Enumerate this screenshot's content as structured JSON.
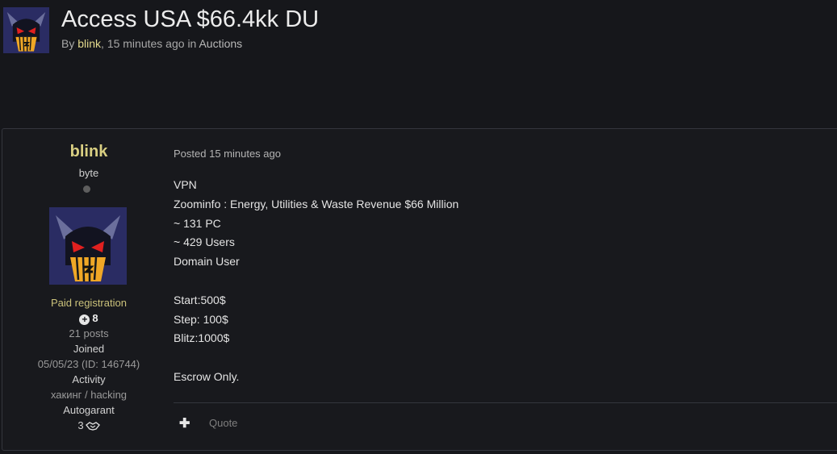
{
  "topic": {
    "title": "Access USA $66.4kk DU",
    "by_label": "By",
    "author": "blink",
    "time_ago": "15 minutes ago",
    "in_label": "in",
    "forum": "Auctions"
  },
  "author_panel": {
    "name": "blink",
    "rank": "byte",
    "group": "Paid registration",
    "reputation": "8",
    "posts": "21 posts",
    "joined_label": "Joined",
    "joined_value": "05/05/23 (ID: 146744)",
    "activity_label": "Activity",
    "activity_value": "хакинг / hacking",
    "autogarant_label": "Autogarant",
    "autogarant_value": "3"
  },
  "post": {
    "date": "Posted 15 minutes ago",
    "lines": [
      "VPN",
      "Zoominfo : Energy, Utilities & Waste Revenue $66 Million",
      "~ 131 PC",
      "~ 429 Users",
      "Domain User",
      "",
      "Start:500$",
      "Step: 100$",
      "Blitz:1000$",
      "",
      "Escrow Only."
    ],
    "quote_label": "Quote"
  },
  "icons": {
    "reputation": "plus-circle-icon",
    "autogarant": "handshake-icon",
    "action": "plus-icon"
  },
  "colors": {
    "background": "#16171b",
    "author_accent": "#d9cf82",
    "group_accent": "#cbc27b"
  }
}
